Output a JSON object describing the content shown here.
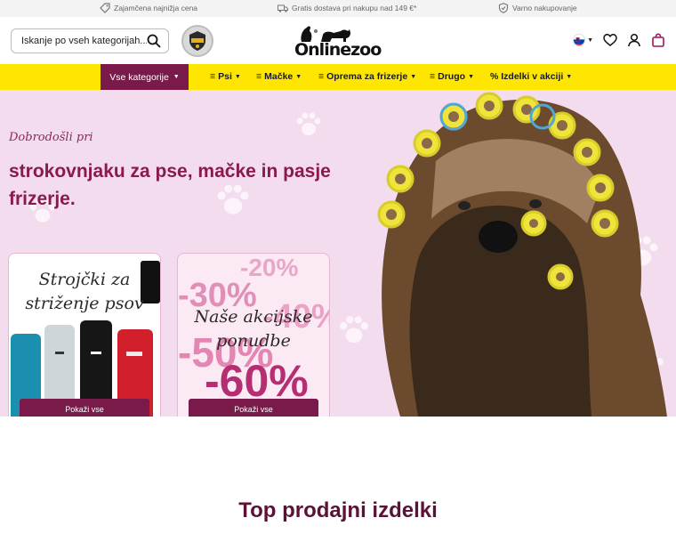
{
  "topbar": {
    "items": [
      {
        "icon": "price-tag-icon",
        "label": "Zajamčena najnižja cena"
      },
      {
        "icon": "delivery-truck-icon",
        "label": "Gratis dostava pri nakupu nad 149 €*"
      },
      {
        "icon": "shield-check-icon",
        "label": "Varno nakupovanje"
      }
    ]
  },
  "header": {
    "search_placeholder": "Iskanje po vseh kategorijah...",
    "logo_text": "Onlinezoo",
    "language": "SI"
  },
  "nav": {
    "all_categories": "Vse kategorije",
    "items": [
      {
        "label": "Psi"
      },
      {
        "label": "Mačke"
      },
      {
        "label": "Oprema za frizerje"
      },
      {
        "label": "Drugo"
      },
      {
        "label": "% Izdelki v akciji"
      }
    ]
  },
  "hero": {
    "welcome": "Dobrodošli pri",
    "headline": "strokovnjaku za pse, mačke in pasje frizerje."
  },
  "cards": [
    {
      "title": "Strojčki za striženje psov",
      "button": "Pokaži vse"
    },
    {
      "title": "Naše akcijske ponudbe",
      "button": "Pokaži vse",
      "discounts": [
        "-20%",
        "-30%",
        "-40%",
        "-50%",
        "-60%"
      ]
    }
  ],
  "section": {
    "title": "Top prodajni izdelki"
  },
  "colors": {
    "accent": "#7a1a4a",
    "nav_bg": "#ffe600",
    "hero_bg": "#f3dced"
  }
}
